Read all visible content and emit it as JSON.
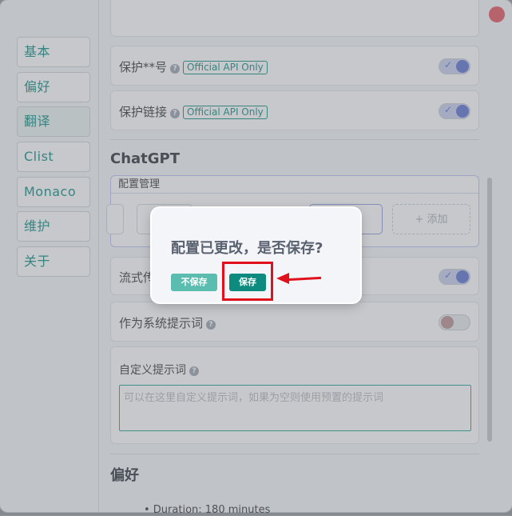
{
  "nav": {
    "items": [
      {
        "label": "基本"
      },
      {
        "label": "偏好"
      },
      {
        "label": "翻译"
      },
      {
        "label": "Clist"
      },
      {
        "label": "Monaco"
      },
      {
        "label": "维护"
      },
      {
        "label": "关于"
      }
    ],
    "active_index": 2
  },
  "settings": {
    "protect_number": {
      "label": "保护**号",
      "tag": "Official API Only",
      "enabled": true
    },
    "protect_link": {
      "label": "保护链接",
      "tag": "Official API Only",
      "enabled": true
    },
    "chatgpt_title": "ChatGPT",
    "config_mgmt": {
      "header": "配置管理",
      "add_label": "+ 添加"
    },
    "stream": {
      "label": "流式传",
      "enabled": true
    },
    "system_prompt": {
      "label": "作为系统提示词",
      "enabled": false
    },
    "custom_prompt": {
      "label": "自定义提示词",
      "placeholder": "可以在这里自定义提示词，如果为空则使用预置的提示词"
    },
    "preferences_title": "偏好"
  },
  "dialog": {
    "title": "配置已更改，是否保存?",
    "no_save_label": "不保存",
    "save_label": "保存"
  },
  "background_doc": {
    "text": "• Duration: 180 minutes"
  },
  "colors": {
    "accent": "#0d8b7f",
    "highlight": "#e0111d",
    "close": "#e4525a"
  }
}
